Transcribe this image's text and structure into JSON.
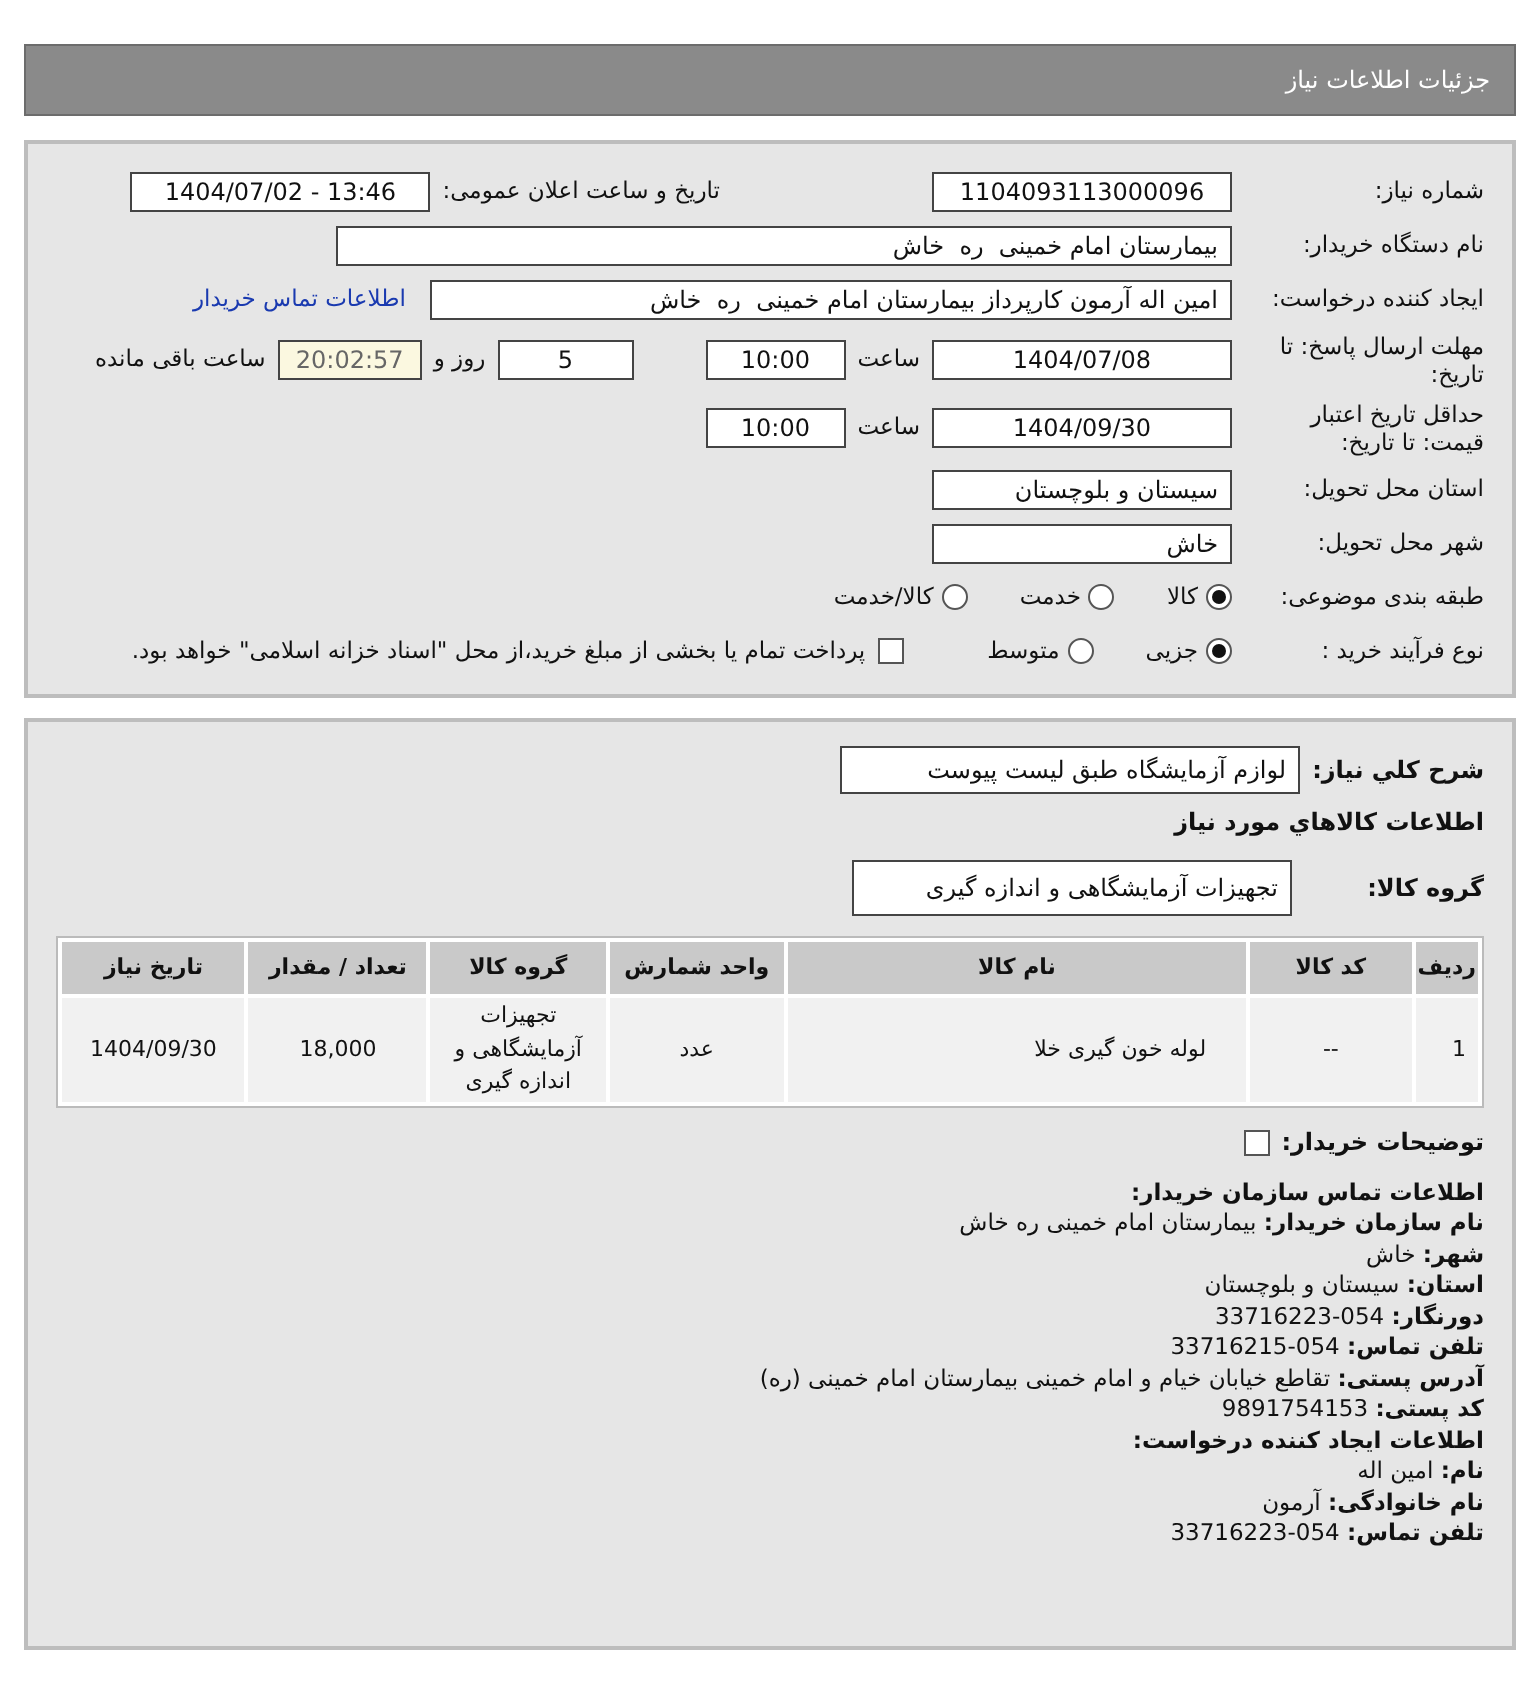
{
  "header": {
    "title": "جزئیات اطلاعات نیاز"
  },
  "need_number": {
    "label": "شماره نیاز:",
    "value": "1104093113000096"
  },
  "announce_date": {
    "label": "تاریخ و ساعت اعلان عمومی:",
    "value": "1404/07/02 - 13:46"
  },
  "buyer_org": {
    "label": "نام دستگاه خریدار:",
    "value": "بیمارستان امام خمینی  ره  خاش"
  },
  "requester": {
    "label": "ایجاد کننده درخواست:",
    "value": "امین اله آرمون کارپرداز بیمارستان امام خمینی  ره  خاش",
    "link": "اطلاعات تماس خریدار"
  },
  "reply_deadline": {
    "label": "مهلت ارسال پاسخ: تا تاریخ:",
    "date": "1404/07/08",
    "time_label": "ساعت",
    "time": "10:00",
    "days": "5",
    "days_label": "روز و",
    "remaining": "20:02:57",
    "remaining_label": "ساعت باقی مانده"
  },
  "price_validity": {
    "label": "حداقل تاریخ اعتبار قیمت: تا تاریخ:",
    "date": "1404/09/30",
    "time_label": "ساعت",
    "time": "10:00"
  },
  "province": {
    "label": "استان محل تحویل:",
    "value": "سیستان و بلوچستان"
  },
  "city": {
    "label": "شهر محل تحویل:",
    "value": "خاش"
  },
  "category": {
    "label": "طبقه بندی موضوعی:",
    "options": [
      {
        "label": "کالا",
        "selected": true
      },
      {
        "label": "خدمت",
        "selected": false
      },
      {
        "label": "کالا/خدمت",
        "selected": false
      }
    ]
  },
  "process": {
    "label": "نوع فرآیند خرید :",
    "options": [
      {
        "label": "جزیی",
        "selected": true
      },
      {
        "label": "متوسط",
        "selected": false
      }
    ],
    "payment": {
      "checked": false,
      "text": "پرداخت تمام یا بخشی از مبلغ خرید،از محل \"اسناد خزانه اسلامی\" خواهد بود."
    }
  },
  "summary": {
    "label": "شرح کلي نياز:",
    "value": "لوازم آزمایشگاه طبق لیست پیوست"
  },
  "goods_heading": "اطلاعات كالاهاي مورد نياز",
  "goods_group": {
    "label": "گروه کالا:",
    "value": "تجهیزات آزمایشگاهی و اندازه گیری"
  },
  "table": {
    "columns": [
      "ردیف",
      "کد کالا",
      "نام کالا",
      "واحد شمارش",
      "گروه کالا",
      "تعداد / مقدار",
      "تاریخ نیاز"
    ],
    "rows": [
      [
        "1",
        "--",
        "لوله خون گیری خلا",
        "عدد",
        "تجهیزات آزمایشگاهی و اندازه گیری",
        "18,000",
        "1404/09/30"
      ]
    ]
  },
  "buyer_notes": {
    "label": "توضیحات خریدار:",
    "checked": false
  },
  "contact": [
    {
      "kind": "heading",
      "text": "اطلاعات تماس سازمان خریدار:"
    },
    {
      "kind": "field",
      "text": "**نام سازمان خریدار:** بیمارستان امام خمینی ره خاش"
    },
    {
      "kind": "field",
      "text": "**شهر:** خاش"
    },
    {
      "kind": "field",
      "text": "**استان:** سیستان و بلوچستان"
    },
    {
      "kind": "field",
      "text": "**دورنگار:** 054-33716223"
    },
    {
      "kind": "field",
      "text": "**تلفن تماس:** 054-33716215"
    },
    {
      "kind": "field",
      "text": "**آدرس پستی:** تقاطع خیابان خیام و امام خمینی بیمارستان امام خمینی (ره)"
    },
    {
      "kind": "field",
      "text": "**کد پستی:** 9891754153"
    },
    {
      "kind": "heading",
      "text": "اطلاعات ایجاد کننده درخواست:"
    },
    {
      "kind": "field",
      "text": "**نام:** امین اله"
    },
    {
      "kind": "field",
      "text": "**نام خانوادگی:** آرمون"
    },
    {
      "kind": "field",
      "text": "**تلفن تماس:** 054-33716223"
    }
  ]
}
